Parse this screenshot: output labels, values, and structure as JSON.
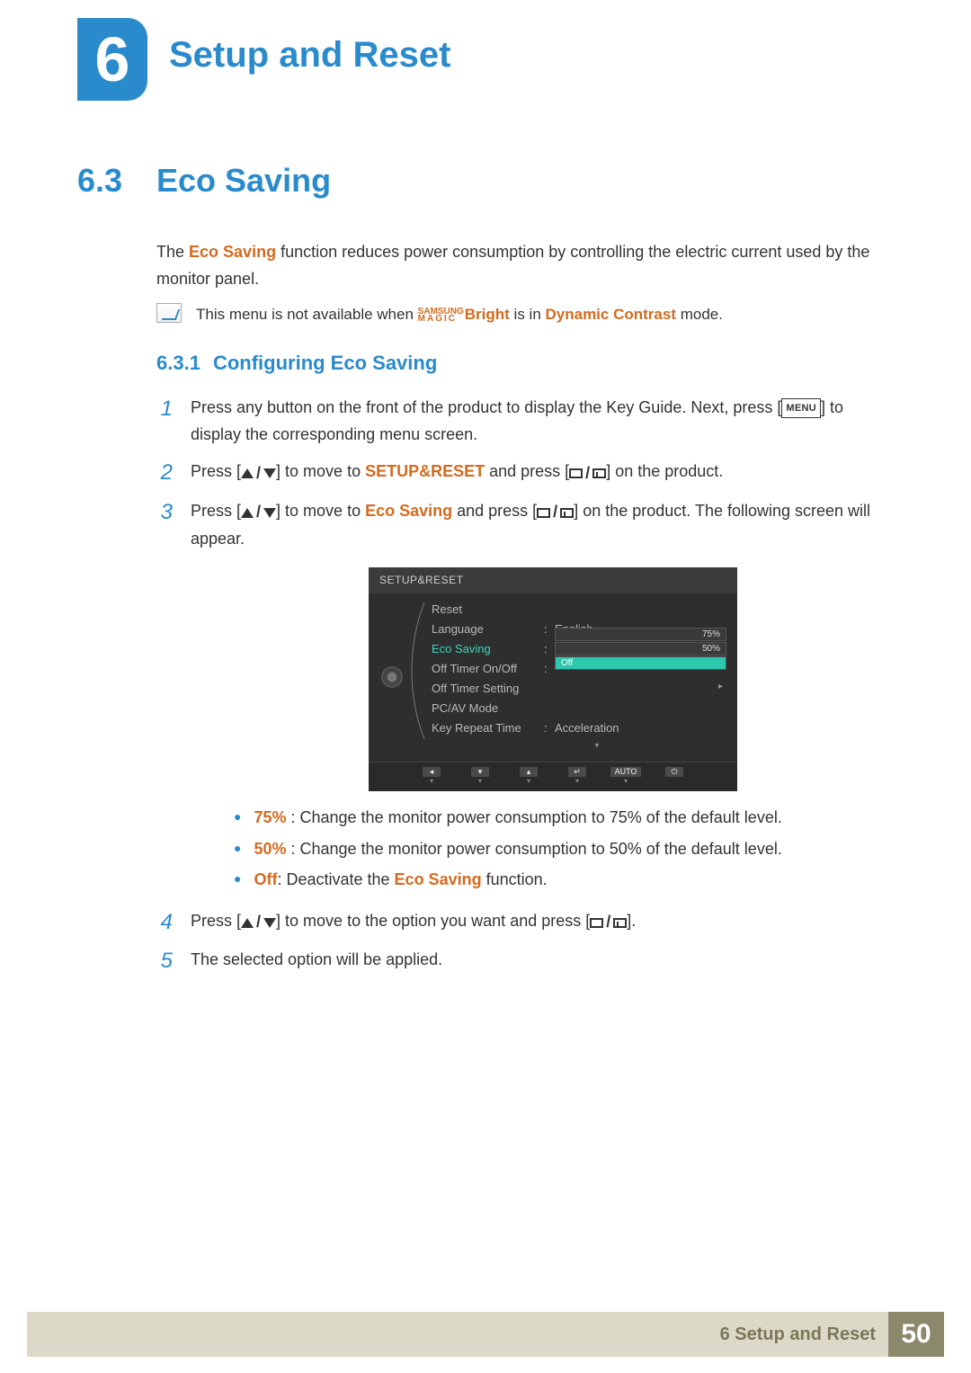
{
  "header": {
    "chapter_number": "6",
    "chapter_title": "Setup and Reset"
  },
  "section": {
    "number": "6.3",
    "title": "Eco Saving",
    "intro_pre": "The ",
    "intro_bold": "Eco Saving",
    "intro_post": " function reduces power consumption by controlling the electric current used by the monitor panel."
  },
  "note": {
    "pre": "This menu is not available when ",
    "magic_top": "SAMSUNG",
    "magic_bottom": "MAGIC",
    "bright": "Bright",
    "mid": " is in ",
    "dc": "Dynamic Contrast",
    "post": " mode."
  },
  "subsection": {
    "number": "6.3.1",
    "title": "Configuring Eco Saving"
  },
  "steps": {
    "s1": {
      "n": "1",
      "a": "Press any button on the front of the product to display the Key Guide. Next, press [",
      "menu": "MENU",
      "b": "] to display the corresponding menu screen."
    },
    "s2": {
      "n": "2",
      "a": "Press [",
      "b": "] to move to ",
      "target": "SETUP&RESET",
      "c": " and press [",
      "d": "] on the product."
    },
    "s3": {
      "n": "3",
      "a": "Press [",
      "b": "] to move to ",
      "target": "Eco Saving",
      "c": " and press [",
      "d": "] on the product. The following screen will appear."
    },
    "s4": {
      "n": "4",
      "a": "Press [",
      "b": "] to move to the option you want and press [",
      "c": "]."
    },
    "s5": {
      "n": "5",
      "text": "The selected option will be applied."
    }
  },
  "bullets": {
    "b1": {
      "k": "75%",
      "v": " : Change the monitor power consumption to 75% of the default level."
    },
    "b2": {
      "k": "50%",
      "v": " : Change the monitor power consumption to 50% of the default level."
    },
    "b3": {
      "k": "Off",
      "mid": ": Deactivate the ",
      "f": "Eco Saving",
      "post": " function."
    }
  },
  "osd": {
    "header": "SETUP&RESET",
    "rows": {
      "reset": "Reset",
      "language": "Language",
      "language_val": "English",
      "eco": "Eco Saving",
      "timer_onoff": "Off Timer On/Off",
      "timer_setting": "Off Timer Setting",
      "pcav": "PC/AV Mode",
      "keyrepeat": "Key Repeat Time",
      "keyrepeat_val": "Acceleration"
    },
    "options": {
      "p75": "75%",
      "p50": "50%",
      "off": "Off"
    },
    "footer": {
      "auto": "AUTO"
    }
  },
  "footer": {
    "label": "6 Setup and Reset",
    "page": "50"
  }
}
